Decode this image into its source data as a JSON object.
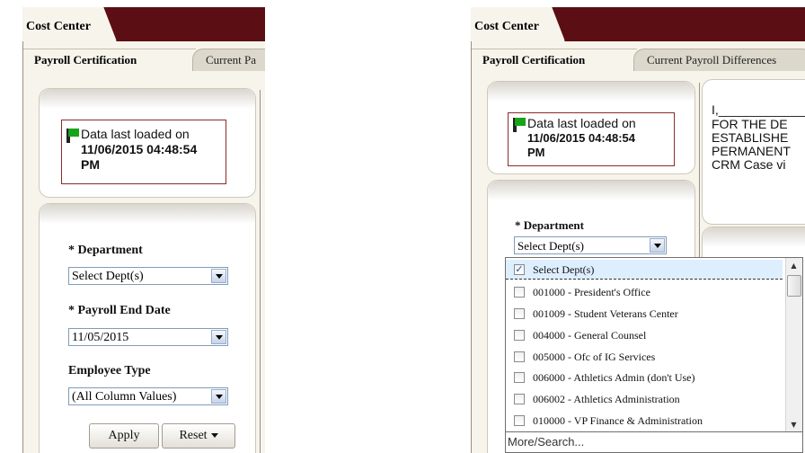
{
  "left": {
    "cost_center_tab": "Cost Center",
    "tabs": [
      "Payroll Certification",
      "Current Pa"
    ],
    "data_loaded": {
      "line1": "Data last loaded on",
      "line2": "11/06/2015 04:48:54",
      "line3": "PM"
    },
    "department": {
      "label": "* Department",
      "value": "Select Dept(s)"
    },
    "payroll_end_date": {
      "label": "* Payroll End Date",
      "value": "11/05/2015"
    },
    "employee_type": {
      "label": "Employee Type",
      "value": "(All Column Values)"
    },
    "apply_label": "Apply",
    "reset_label": "Reset"
  },
  "right": {
    "cost_center_tab": "Cost Center",
    "tabs": [
      "Payroll Certification",
      "Current Payroll Differences"
    ],
    "data_loaded": {
      "line1": "Data last loaded on",
      "line2": "11/06/2015 04:48:54",
      "line3": "PM"
    },
    "cert_text": [
      "I,__________________________",
      "FOR THE DE",
      "ESTABLISHE",
      "PERMANENT",
      "CRM Case vi"
    ],
    "department": {
      "label": "* Department",
      "value": "Select Dept(s)"
    },
    "dropdown": {
      "items": [
        {
          "label": "Select Dept(s)",
          "checked": true
        },
        {
          "label": "001000 - President's Office",
          "checked": false
        },
        {
          "label": "001009 - Student Veterans Center",
          "checked": false
        },
        {
          "label": "004000 - General Counsel",
          "checked": false
        },
        {
          "label": "005000 - Ofc of IG Services",
          "checked": false
        },
        {
          "label": "006000 - Athletics Admin (don't Use)",
          "checked": false
        },
        {
          "label": "006002 - Athletics Administration",
          "checked": false
        },
        {
          "label": "010000 - VP Finance & Administration",
          "checked": false
        }
      ],
      "more_search": "More/Search..."
    }
  },
  "colors": {
    "header": "#5b0e13",
    "panel_bg": "#f7f4ec",
    "flag_green": "#18a318",
    "border_red": "#8b2b2b"
  }
}
